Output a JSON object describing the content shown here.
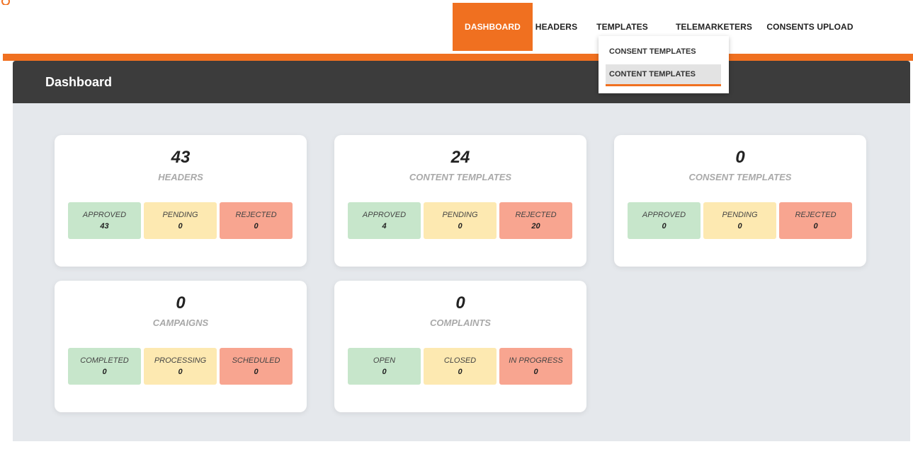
{
  "nav": {
    "items": [
      {
        "label": "DASHBOARD"
      },
      {
        "label": "HEADERS"
      },
      {
        "label": "TEMPLATES"
      },
      {
        "label": "TELEMARKETERS"
      },
      {
        "label": "CONSENTS UPLOAD"
      }
    ],
    "active": "DASHBOARD"
  },
  "dropdown": {
    "items": [
      {
        "label": "CONSENT TEMPLATES"
      },
      {
        "label": "CONTENT TEMPLATES"
      }
    ],
    "highlighted": "CONTENT TEMPLATES"
  },
  "panel": {
    "title": "Dashboard"
  },
  "cards": [
    {
      "count": "43",
      "label": "HEADERS",
      "stats": [
        {
          "label": "APPROVED",
          "value": "43"
        },
        {
          "label": "PENDING",
          "value": "0"
        },
        {
          "label": "REJECTED",
          "value": "0"
        }
      ]
    },
    {
      "count": "24",
      "label": "CONTENT TEMPLATES",
      "stats": [
        {
          "label": "APPROVED",
          "value": "4"
        },
        {
          "label": "PENDING",
          "value": "0"
        },
        {
          "label": "REJECTED",
          "value": "20"
        }
      ]
    },
    {
      "count": "0",
      "label": "CONSENT TEMPLATES",
      "stats": [
        {
          "label": "APPROVED",
          "value": "0"
        },
        {
          "label": "PENDING",
          "value": "0"
        },
        {
          "label": "REJECTED",
          "value": "0"
        }
      ]
    },
    {
      "count": "0",
      "label": "CAMPAIGNS",
      "stats": [
        {
          "label": "COMPLETED",
          "value": "0"
        },
        {
          "label": "PROCESSING",
          "value": "0"
        },
        {
          "label": "SCHEDULED",
          "value": "0"
        }
      ]
    },
    {
      "count": "0",
      "label": "COMPLAINTS",
      "stats": [
        {
          "label": "OPEN",
          "value": "0"
        },
        {
          "label": "CLOSED",
          "value": "0"
        },
        {
          "label": "IN PROGRESS",
          "value": "0"
        }
      ]
    }
  ],
  "colors": {
    "accent": "#f07020",
    "header_bg": "#3c3c3c",
    "panel_bg": "#e5e8ec",
    "green": "#c7e6cb",
    "yellow": "#fde9b1",
    "red": "#f8a590"
  }
}
